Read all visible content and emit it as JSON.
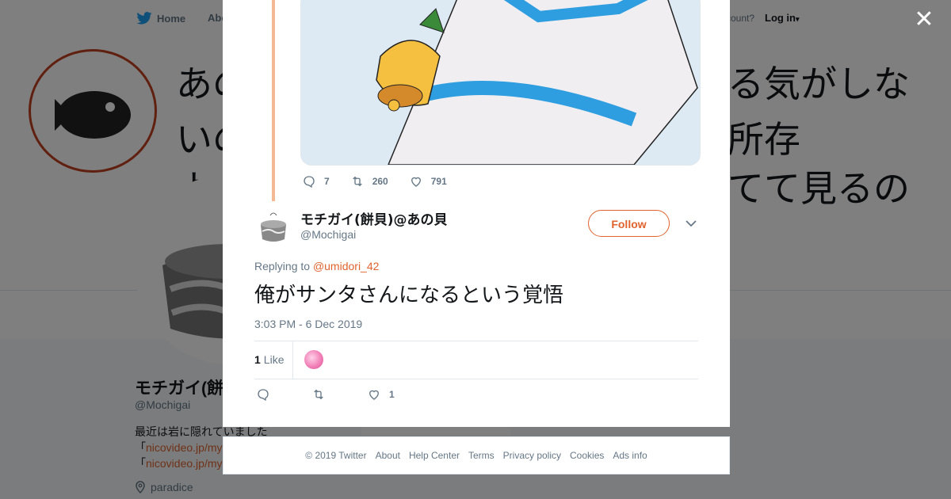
{
  "nav": {
    "home_label": "Home",
    "about_label": "Abo",
    "account_prompt": "ccount?",
    "login_label": "Log in"
  },
  "background": {
    "banner_lines": [
      "あの",
      "いの",
      "よ",
      "る気がしな",
      "所存",
      "てて見るの"
    ],
    "profile_name": "モチガイ(餅",
    "profile_handle": "@Mochigai",
    "bio_line1": "最近は岩に隠れていました",
    "bio_link1": "nicovideo.jp/my",
    "bio_link2": "nicovideo.jp/my",
    "location": "paradice",
    "ads_info_partial": "Ads info"
  },
  "modal": {
    "top_actions": {
      "replies": "7",
      "retweets": "260",
      "likes": "791"
    },
    "author_name": "モチガイ(餅貝)@あの貝",
    "author_handle": "@Mochigai",
    "follow_label": "Follow",
    "reply_prefix": "Replying to",
    "reply_mention": "@umidori_42",
    "text": "俺がサンタさんになるという覚悟",
    "timestamp": "3:03 PM - 6 Dec 2019",
    "like_count": "1",
    "like_label": "Like",
    "bottom_actions": {
      "likes": "1"
    }
  },
  "footer": {
    "links": [
      "© 2019 Twitter",
      "About",
      "Help Center",
      "Terms",
      "Privacy policy",
      "Cookies",
      "Ads info"
    ]
  },
  "colors": {
    "accent": "#e0632e",
    "thread_line": "#f5b895",
    "twitter_blue": "#1da1f2"
  }
}
